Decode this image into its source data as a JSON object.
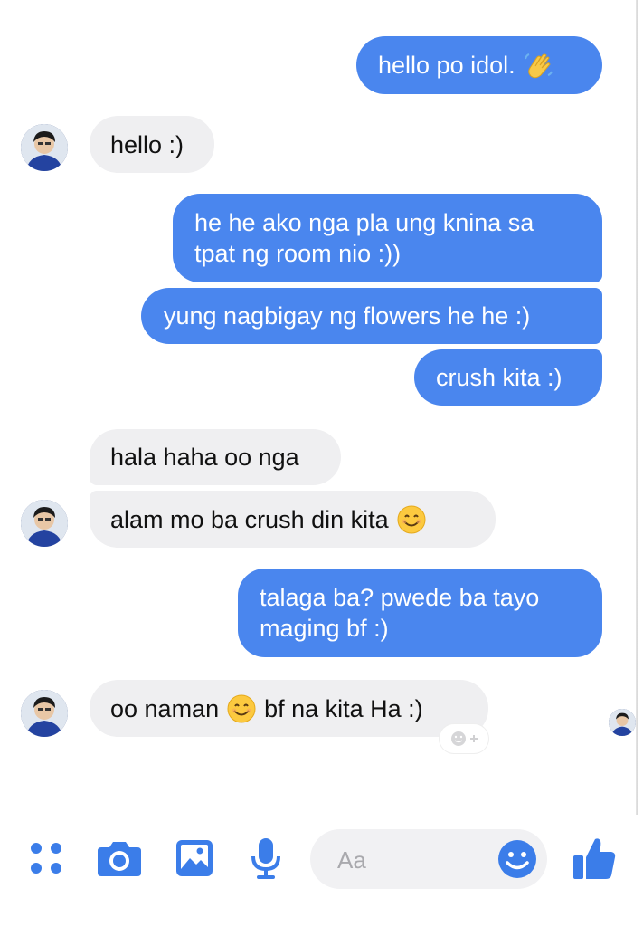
{
  "messages": {
    "m1": {
      "text": "hello po idol."
    },
    "m2": {
      "text": "hello :)"
    },
    "m3": {
      "line1": "he he ako nga pla ung knina sa",
      "line2": "tpat ng room nio :))"
    },
    "m4": {
      "text": "yung nagbigay ng flowers he he :)"
    },
    "m5": {
      "text": "crush kita :)"
    },
    "m6": {
      "text": "hala haha oo nga"
    },
    "m7": {
      "text": "alam mo ba crush din kita"
    },
    "m8": {
      "line1": "talaga ba? pwede ba tayo",
      "line2": "maging bf :)"
    },
    "m9": {
      "text_before": "oo naman",
      "text_after": "bf na kita Ha :)"
    }
  },
  "composer": {
    "placeholder": "Aa"
  },
  "colors": {
    "outgoing": "#4a86ee",
    "incoming": "#efeff1",
    "accent": "#3b7de9"
  },
  "icons": [
    "apps-icon",
    "camera-icon",
    "image-icon",
    "microphone-icon",
    "emoji-icon",
    "thumbs-up-icon",
    "waving-hand-icon",
    "smile-emoji-icon",
    "add-reaction-icon"
  ]
}
